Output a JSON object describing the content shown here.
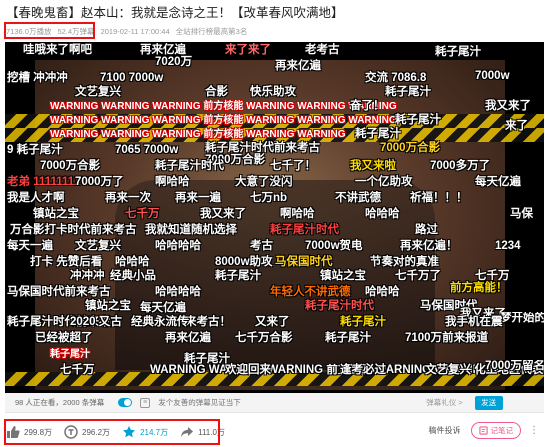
{
  "title": "【春晚鬼畜】赵本山：我就是念诗之王！【改革春风吹满地】",
  "meta": {
    "views": "7136.0万播放",
    "danmaku_count": "52.4万弹幕",
    "date": "2019-02-11 17:00:44",
    "rank": "全站排行榜最高第3名"
  },
  "danmaku": [
    "哇哦来了啊吧",
    "再来亿遍",
    "来了来了",
    "老考古",
    "7020万",
    "耗子尾汁",
    "7100 7000w",
    "挖槽 冲冲冲",
    "再来亿遍",
    "交流 7086.8",
    "7000w",
    "文艺复兴",
    "合影",
    "快乐助攻",
    "耗子尾汁",
    "WARNING WARNING WARNING 前方核能 WARNING WARNING WARNING",
    "奋了！",
    "我又来了",
    "WARNING WARNING WARNING 前方核能 WARNING WARNING WARNING",
    "耗子尾汁",
    "来了",
    "WARNING WARNING WARNING 前方核能 WARNING WARNING",
    "耗子尾汁",
    "9 耗子尾汁",
    "7065 7000w",
    "耗子尾汁时代前来考古",
    "7000万合影",
    "7000万合影",
    "7000万合影",
    "耗子尾汁时代",
    "七千了！",
    "我又来啦",
    "7000多万了",
    "老弟 11111111",
    "7000万了",
    "啊哈哈",
    "大意了没闪",
    "一个亿助攻",
    "每天亿遍",
    "我是人才啊",
    "再来一次",
    "再来一遍",
    "七万nb",
    "不讲武德",
    "祈福！！！",
    "镇站之宝",
    "七千万",
    "我又来了",
    "啊哈哈",
    "哈哈哈",
    "马保",
    "万合影打卡时代前来考古",
    "我就知道随机选择",
    "耗子尾汁时代",
    "路过",
    "每天一遍",
    "文艺复兴",
    "哈哈哈哈",
    "考古",
    "7000w贺电",
    "再来亿遍！",
    "1234",
    "打卡 先赞后看",
    "哈哈哈",
    "8000w助攻",
    "马保国时代",
    "节奏对的真准",
    "冲冲冲",
    "经典小品",
    "耗子尾汁",
    "镇站之宝",
    "七千万了",
    "七千万",
    "马保国时代前来考古",
    "哈哈哈哈",
    "年轻人不讲武德",
    "哈哈哈",
    "前方高能！",
    "镇站之宝",
    "每天亿遍",
    "耗子尾汁时代",
    "马保国时代",
    "我又来了",
    "梦开始的地方",
    "耗子尾汁时代前来考古",
    "2020 又",
    "来考古！",
    "又来了",
    "耗子尾汁",
    "我手机在震",
    "已经被超了",
    "再来亿遍",
    "七千万合影",
    "耗子尾汁",
    "7100万前来报道",
    "耗子尾汁",
    "七千万",
    "WARNING WARNING WARNING 前方高能 WARNING WARNING WARNING",
    "欢迎回来",
    "逢考必过",
    "文艺复兴 化工地区代表",
    "7000万留名",
    "经典永流传",
    "耗子尾汁"
  ],
  "controls": {
    "viewers": "98 人正在看，2000 条弹幕",
    "input_placeholder": "发个友善的弹幕见证当下",
    "etiquette": "弹幕礼仪 >",
    "send": "发送"
  },
  "actions": {
    "like": "299.8万",
    "coin": "296.2万",
    "favorite": "214.7万",
    "share": "111.0万"
  },
  "right_tools": {
    "report": "稿件投诉",
    "note": "记笔记"
  },
  "colors": {
    "accent": "#00a1d6",
    "highlight_box": "#e11111",
    "note_pink": "#f25d8e"
  }
}
